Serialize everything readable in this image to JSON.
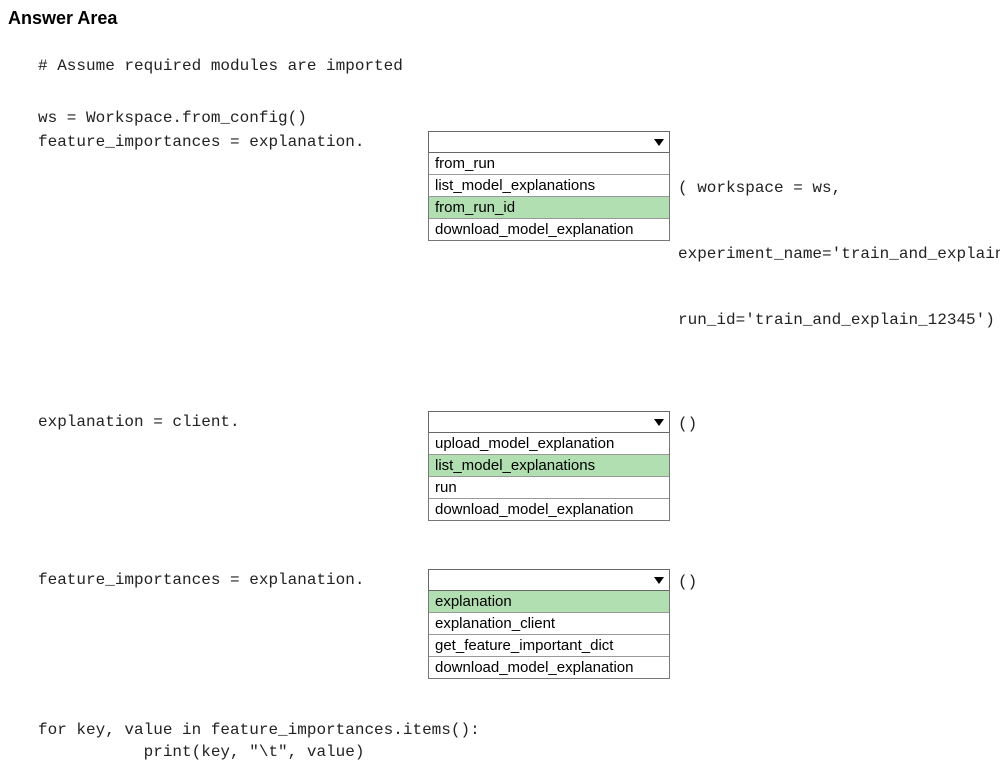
{
  "title": "Answer Area",
  "code": {
    "comment": "# Assume required modules are imported",
    "ws_line": "ws = Workspace.from_config()",
    "line1_lhs": "feature_importances = explanation.",
    "line1_rhs1": "( workspace = ws,",
    "line1_rhs2": "experiment_name='train_and_explain',",
    "line1_rhs3": "run_id='train_and_explain_12345')",
    "line2_lhs": "explanation = client.",
    "line2_rhs": "()",
    "line3_lhs": "feature_importances = explanation.",
    "line3_rhs": "()",
    "for_line": "for key, value in feature_importances.items():",
    "print_line": "           print(key, \"\\t\", value)"
  },
  "dropdown1": {
    "options": [
      {
        "label": "from_run",
        "selected": false
      },
      {
        "label": "list_model_explanations",
        "selected": false
      },
      {
        "label": "from_run_id",
        "selected": true
      },
      {
        "label": "download_model_explanation",
        "selected": false
      }
    ]
  },
  "dropdown2": {
    "options": [
      {
        "label": "upload_model_explanation",
        "selected": false
      },
      {
        "label": "list_model_explanations",
        "selected": true
      },
      {
        "label": "run",
        "selected": false
      },
      {
        "label": "download_model_explanation",
        "selected": false
      }
    ]
  },
  "dropdown3": {
    "options": [
      {
        "label": "explanation",
        "selected": true
      },
      {
        "label": "explanation_client",
        "selected": false
      },
      {
        "label": "get_feature_important_dict",
        "selected": false
      },
      {
        "label": "download_model_explanation",
        "selected": false
      }
    ]
  }
}
